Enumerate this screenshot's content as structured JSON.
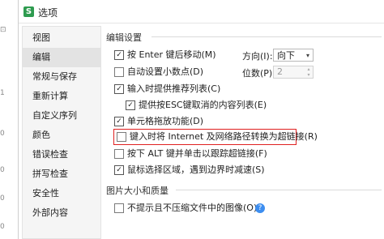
{
  "window": {
    "title": "选项",
    "app_icon_letter": "S"
  },
  "left_strip": {
    "glyphs": [
      "⊡",
      "1",
      "0",
      "0",
      "0",
      "0"
    ]
  },
  "sidebar": {
    "items": [
      {
        "label": "视图",
        "active": false
      },
      {
        "label": "编辑",
        "active": true
      },
      {
        "label": "常规与保存",
        "active": false
      },
      {
        "label": "重新计算",
        "active": false
      },
      {
        "label": "自定义序列",
        "active": false
      },
      {
        "label": "颜色",
        "active": false
      },
      {
        "label": "错误检查",
        "active": false
      },
      {
        "label": "拼写检查",
        "active": false
      },
      {
        "label": "安全性",
        "active": false
      },
      {
        "label": "外部内容",
        "active": false
      }
    ]
  },
  "edit_settings": {
    "section_title": "编辑设置",
    "options": [
      {
        "label": "按 Enter 键后移动(M)",
        "checked": true
      },
      {
        "label": "自动设置小数点(D)",
        "checked": false
      },
      {
        "label": "输入时提供推荐列表(C)",
        "checked": true
      },
      {
        "label": "提供按ESC键取消的内容列表(E)",
        "checked": true
      },
      {
        "label": "单元格拖放功能(D)",
        "checked": true
      },
      {
        "label": "键入时将 Internet 及网络路径转换为超链接(R)",
        "checked": false
      },
      {
        "label": "按下 ALT 键并单击以跟踪超链接(F)",
        "checked": false
      },
      {
        "label": "鼠标选择区域，遇到边界时减速(S)",
        "checked": true
      }
    ],
    "direction": {
      "label": "方向(I):",
      "value": "向下"
    },
    "places": {
      "label": "位数(P):",
      "value": "2"
    }
  },
  "image_quality": {
    "section_title": "图片大小和质量",
    "options": [
      {
        "label": "不提示且不压缩文件中的图像(O)",
        "checked": false
      }
    ]
  },
  "icons": {
    "checkmark": "✓",
    "chevron_down": "▾",
    "spin_up": "▴",
    "spin_down": "▾",
    "help": "?"
  },
  "colors": {
    "highlight": "#e02020",
    "help": "#3d8ef0",
    "app_icon": "#2e9b4f"
  }
}
